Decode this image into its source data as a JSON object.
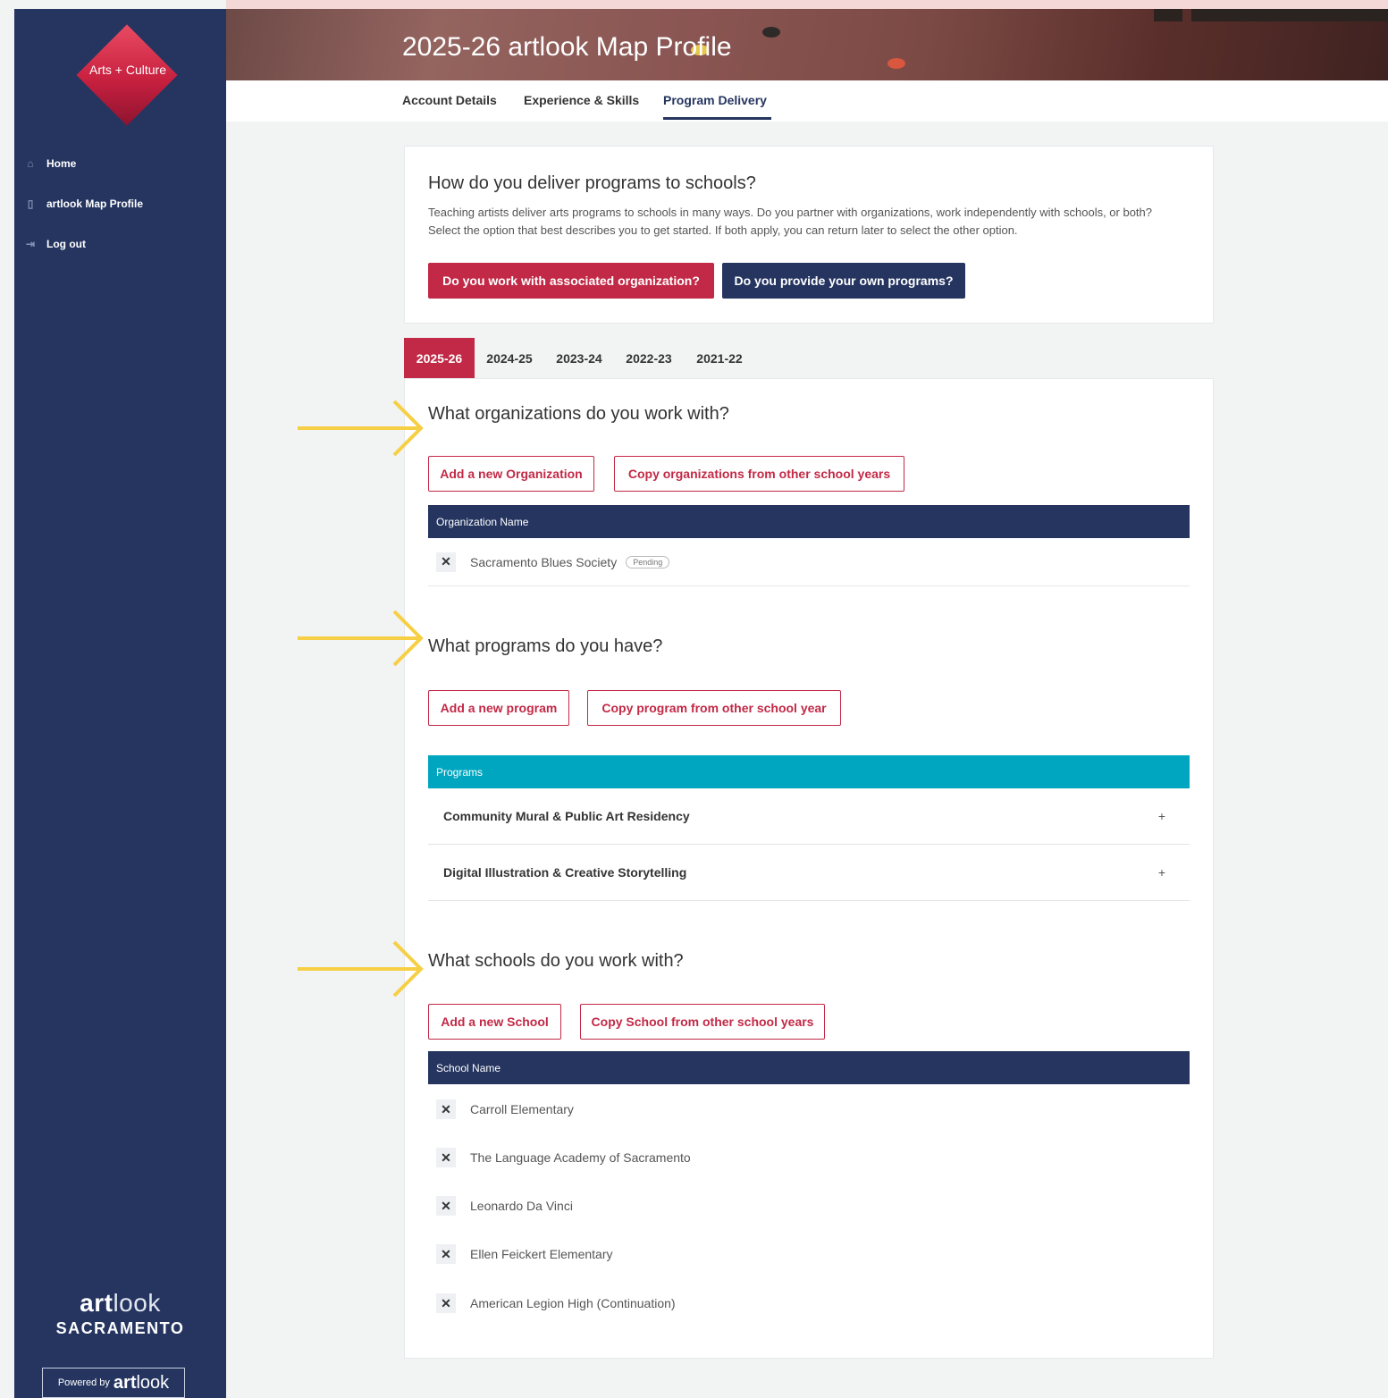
{
  "sidebar": {
    "logo_text": "Arts + Culture",
    "nav": [
      {
        "label": "Home",
        "icon": "home-icon"
      },
      {
        "label": "artlook Map Profile",
        "icon": "map-icon"
      },
      {
        "label": "Log out",
        "icon": "logout-icon"
      }
    ],
    "brand_bold": "art",
    "brand_light": "look",
    "brand_city": "SACRAMENTO",
    "powered_prefix": "Powered by",
    "powered_bold": "art",
    "powered_light": "look"
  },
  "header": {
    "title": "2025-26 artlook Map Profile",
    "tabs": [
      "Account Details",
      "Experience & Skills",
      "Program Delivery"
    ],
    "active_tab": "Program Delivery"
  },
  "intro": {
    "heading": "How do you deliver programs to schools?",
    "text": "Teaching artists deliver arts programs to schools in many ways. Do you partner with organizations, work independently with schools, or both? Select the option that best describes you to get started. If both apply, you can return later to select the other option.",
    "btn_org": "Do you work with associated organization?",
    "btn_own": "Do you provide your own programs?"
  },
  "year_tabs": [
    "2025-26",
    "2024-25",
    "2023-24",
    "2022-23",
    "2021-22"
  ],
  "active_year": "2025-26",
  "organizations": {
    "heading": "What organizations do you work with?",
    "add_btn": "Add a new Organization",
    "copy_btn": "Copy organizations from other school years",
    "column": "Organization Name",
    "rows": [
      {
        "name": "Sacramento Blues Society",
        "status": "Pending"
      }
    ]
  },
  "programs": {
    "heading": "What programs do you have?",
    "add_btn": "Add a new program",
    "copy_btn": "Copy program from other school year",
    "column": "Programs",
    "rows": [
      "Community Mural & Public Art Residency",
      "Digital Illustration & Creative Storytelling"
    ],
    "expand_glyph": "+"
  },
  "schools": {
    "heading": "What schools do you work with?",
    "add_btn": "Add a new School",
    "copy_btn": "Copy School from other school years",
    "column": "School Name",
    "rows": [
      "Carroll Elementary",
      "The Language Academy of Sacramento",
      "Leonardo Da Vinci",
      "Ellen Feickert Elementary",
      "American Legion High (Continuation)"
    ]
  },
  "remove_glyph": "✕",
  "colors": {
    "sidebar": "#253560",
    "accent_red": "#c22946",
    "navy": "#253560",
    "teal": "#00a6bf",
    "arrow_yellow": "#f7cf45"
  }
}
